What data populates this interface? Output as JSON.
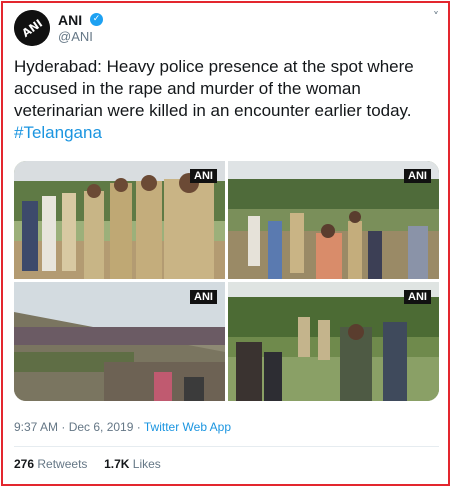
{
  "tweet": {
    "author_name": "ANI",
    "author_handle": "@ANI",
    "avatar_text": "ANI",
    "verified_icon": "✓",
    "menu_icon": "˅",
    "text_main": "Hyderabad: Heavy police presence at the spot where accused in the rape and murder of the woman veterinarian were killed in an encounter earlier today.",
    "hashtag": "#Telangana",
    "timestamp": "9:37 AM · Dec 6, 2019 · ",
    "source": "Twitter Web App",
    "retweets_count": "276",
    "retweets_label": "Retweets",
    "likes_count": "1.7K",
    "likes_label": "Likes"
  },
  "media": {
    "watermark": "ANI"
  },
  "colors": {
    "border": "#e3262e",
    "link": "#1b95e0",
    "verified": "#1da1f2"
  }
}
